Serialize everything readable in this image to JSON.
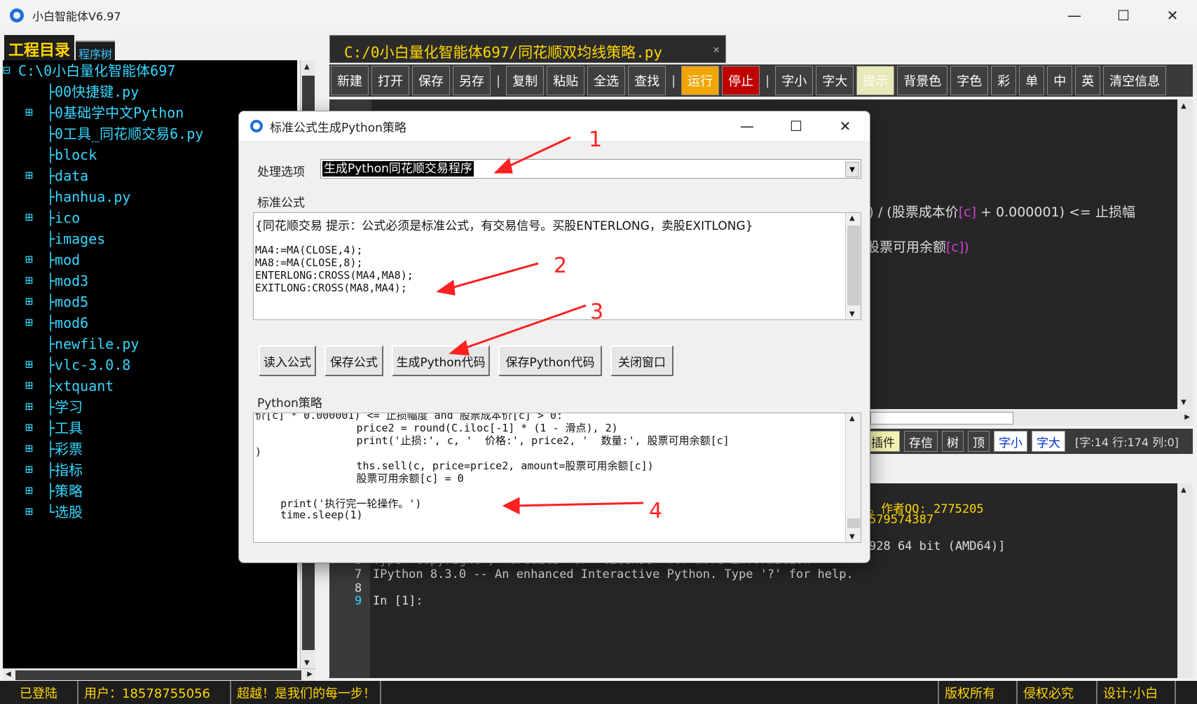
{
  "app": {
    "title": "小白智能体V6.97",
    "minimize": "—",
    "maximize": "☐",
    "close": "✕"
  },
  "left": {
    "tab_project": "工程目录",
    "tab_tree": "程序树",
    "tree": [
      {
        "exp": "⊟",
        "label": "C:\\0小白量化智能体697",
        "root": true
      },
      {
        "exp": "",
        "label": "├00快捷键.py"
      },
      {
        "exp": "⊞",
        "label": "├0基础学中文Python"
      },
      {
        "exp": "",
        "label": "├0工具_同花顺交易6.py"
      },
      {
        "exp": "",
        "label": "├block"
      },
      {
        "exp": "⊞",
        "label": "├data"
      },
      {
        "exp": "",
        "label": "├hanhua.py"
      },
      {
        "exp": "⊞",
        "label": "├ico"
      },
      {
        "exp": "",
        "label": "├images"
      },
      {
        "exp": "⊞",
        "label": "├mod"
      },
      {
        "exp": "⊞",
        "label": "├mod3"
      },
      {
        "exp": "⊞",
        "label": "├mod5"
      },
      {
        "exp": "⊞",
        "label": "├mod6"
      },
      {
        "exp": "",
        "label": "├newfile.py"
      },
      {
        "exp": "⊞",
        "label": "├vlc-3.0.8"
      },
      {
        "exp": "⊞",
        "label": "├xtquant"
      },
      {
        "exp": "⊞",
        "label": "├学习"
      },
      {
        "exp": "⊞",
        "label": "├工具"
      },
      {
        "exp": "⊞",
        "label": "├彩票"
      },
      {
        "exp": "⊞",
        "label": "├指标"
      },
      {
        "exp": "⊞",
        "label": "├策略"
      },
      {
        "exp": "⊞",
        "label": "└选股"
      }
    ]
  },
  "editor": {
    "tab_title": "C:/0小白量化智能体697/同花顺双均线策略.py",
    "tab_close": "×",
    "toolbar": [
      "新建",
      "打开",
      "保存",
      "另存",
      "|",
      "复制",
      "粘贴",
      "全选",
      "查找",
      "|",
      "运行",
      "停止",
      "|",
      "字小",
      "字大",
      "提示",
      "背景色",
      "字色",
      "彩",
      "单",
      "中",
      "英",
      "清空信息"
    ],
    "code_lines": [
      {
        "t1": "]) / (股票成本价",
        "p1": "[c]",
        "t2": " + 0.000001) <= 止损幅",
        "p2": ""
      },
      {
        "t1": "股票可用余额",
        "p1": "[c])",
        "t2": "",
        "p2": ""
      }
    ],
    "code_toolbar": [
      "插件",
      "存信",
      "树",
      "顶",
      "字小",
      "字大",
      "[字:14 行:174 列:0]"
    ]
  },
  "console": {
    "lines": [
      {
        "text": "。作者QQ: 2775205",
        "cls": "yellow"
      },
      {
        "text": "579574387",
        "cls": "yellow"
      },
      {
        "text": "928 64 bit (AMD64)]",
        "cls": ""
      },
      {
        "text": "Type \"copyright\", \"credits\" or \"license\" for more information",
        "cls": ""
      },
      {
        "text": "IPython 8.3.0 -- An enhanced Interactive Python. Type '?' for help.",
        "cls": ""
      },
      {
        "text": "",
        "cls": ""
      },
      {
        "text": "In [1]:",
        "cls": ""
      }
    ],
    "line_numbers": [
      "6",
      "7",
      "8",
      "9"
    ]
  },
  "status": [
    "已登陆",
    "用户：18578755056",
    "超越！是我们的每一步！",
    "版权所有",
    "侵权必究",
    "设计:小白"
  ],
  "dialog": {
    "title": "标准公式生成Python策略",
    "option_label": "处理选项",
    "option_value": "生成Python同花顺交易程序",
    "formula_label": "标准公式",
    "formula_lines": [
      "{同花顺交易  提示：公式必须是标准公式，有交易信号。买股ENTERLONG，卖股EXITLONG}",
      "",
      "MA4:=MA(CLOSE,4);",
      "MA8:=MA(CLOSE,8);",
      "ENTERLONG:CROSS(MA4,MA8);",
      "EXITLONG:CROSS(MA8,MA4);"
    ],
    "buttons": [
      "读入公式",
      "保存公式",
      "生成Python代码",
      "保存Python代码",
      "关闭窗口"
    ],
    "python_label": "Python策略",
    "python_lines": [
      "价[c] * 0.000001) <= 止损幅度 and 股票成本价[c] > 0:",
      "                price2 = round(C.iloc[-1] * (1 - 滑点), 2)",
      "                print('止损:', c, '  价格:', price2, '  数量:', 股票可用余额[c]",
      ")",
      "                ths.sell(c, price=price2, amount=股票可用余额[c])",
      "                股票可用余额[c] = 0",
      "",
      "    print('执行完一轮操作。')",
      "    time.sleep(1)"
    ]
  },
  "annotations": [
    "1",
    "2",
    "3",
    "4"
  ]
}
